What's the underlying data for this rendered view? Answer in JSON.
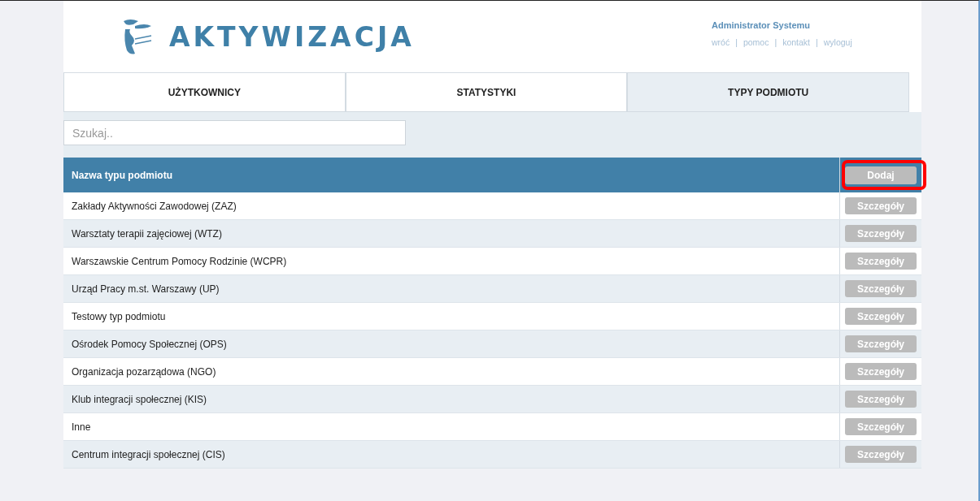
{
  "header": {
    "logo_text": "AKTYWIZACJA",
    "user": "Administrator Systemu",
    "links": [
      "wróć",
      "pomoc",
      "kontakt",
      "wyloguj"
    ],
    "separator": "|"
  },
  "tabs": [
    {
      "label": "UŻYTKOWNICY",
      "selected": false
    },
    {
      "label": "STATYSTYKI",
      "selected": false
    },
    {
      "label": "TYPY PODMIOTU",
      "selected": true
    }
  ],
  "search": {
    "placeholder": "Szukaj.."
  },
  "table": {
    "column": "Nazwa typu podmiotu",
    "add_button": {
      "label": "Dodaj",
      "highlighted": true
    },
    "rows": [
      {
        "name": "Zakłady Aktywności Zawodowej (ZAZ)",
        "button": "Szczegóły"
      },
      {
        "name": "Warsztaty terapii zajęciowej (WTZ)",
        "button": "Szczegóły"
      },
      {
        "name": "Warszawskie Centrum Pomocy Rodzinie (WCPR)",
        "button": "Szczegóły"
      },
      {
        "name": "Urząd Pracy m.st. Warszawy (UP)",
        "button": "Szczegóły"
      },
      {
        "name": "Testowy typ podmiotu",
        "button": "Szczegóły"
      },
      {
        "name": "Ośrodek Pomocy Społecznej (OPS)",
        "button": "Szczegóły"
      },
      {
        "name": "Organizacja pozarządowa (NGO)",
        "button": "Szczegóły"
      },
      {
        "name": "Klub integracji społecznej (KIS)",
        "button": "Szczegóły"
      },
      {
        "name": "Inne",
        "button": "Szczegóły"
      },
      {
        "name": "Centrum integracji społecznej (CIS)",
        "button": "Szczegóły"
      }
    ]
  }
}
